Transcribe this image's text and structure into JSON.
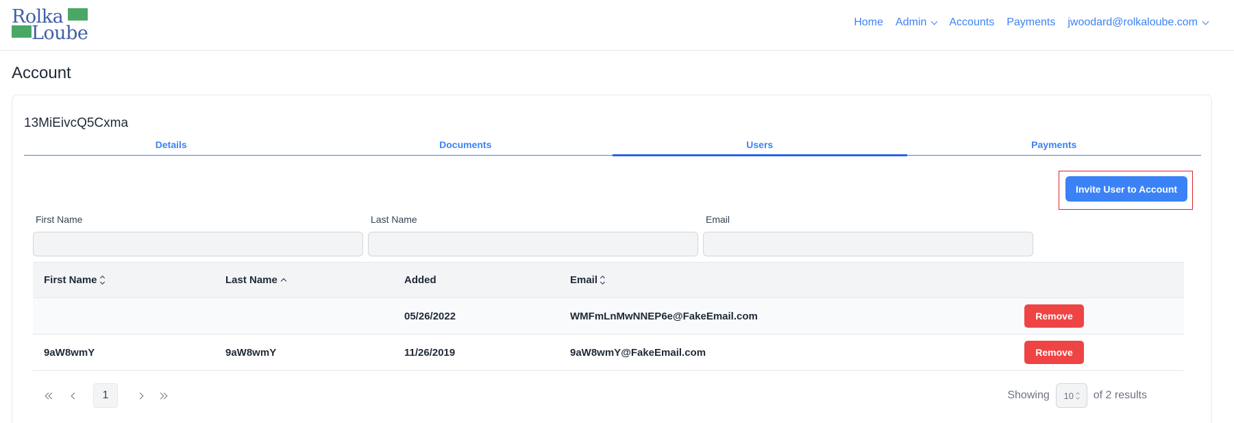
{
  "brand": {
    "line1": "Rolka",
    "line2": "Loube",
    "text_color": "#3f5fa8",
    "accent_color": "#4aa765"
  },
  "nav": {
    "home": "Home",
    "admin": "Admin",
    "accounts": "Accounts",
    "payments": "Payments",
    "user": "jwoodard@rolkaloube.com"
  },
  "page": {
    "title": "Account"
  },
  "account": {
    "id": "13MiEivcQ5Cxma"
  },
  "tabs": [
    {
      "label": "Details",
      "active": false
    },
    {
      "label": "Documents",
      "active": false
    },
    {
      "label": "Users",
      "active": true
    },
    {
      "label": "Payments",
      "active": false
    }
  ],
  "actions": {
    "invite_label": "Invite User to Account"
  },
  "filters": {
    "first_name_label": "First Name",
    "last_name_label": "Last Name",
    "email_label": "Email",
    "first_name_value": "",
    "last_name_value": "",
    "email_value": ""
  },
  "table": {
    "headers": {
      "first_name": "First Name",
      "last_name": "Last Name",
      "added": "Added",
      "email": "Email"
    },
    "rows": [
      {
        "first_name": "",
        "last_name": "",
        "added": "05/26/2022",
        "email": "WMFmLnMwNNEP6e@FakeEmail.com",
        "action": "Remove"
      },
      {
        "first_name": "9aW8wmY",
        "last_name": "9aW8wmY",
        "added": "11/26/2019",
        "email": "9aW8wmY@FakeEmail.com",
        "action": "Remove"
      }
    ]
  },
  "pagination": {
    "current_page": "1",
    "showing_label": "Showing",
    "page_size": "10",
    "results_label": "of 2 results"
  },
  "colors": {
    "primary": "#3b82f6",
    "danger": "#ef4444",
    "highlight_outline": "#e11d2c"
  }
}
